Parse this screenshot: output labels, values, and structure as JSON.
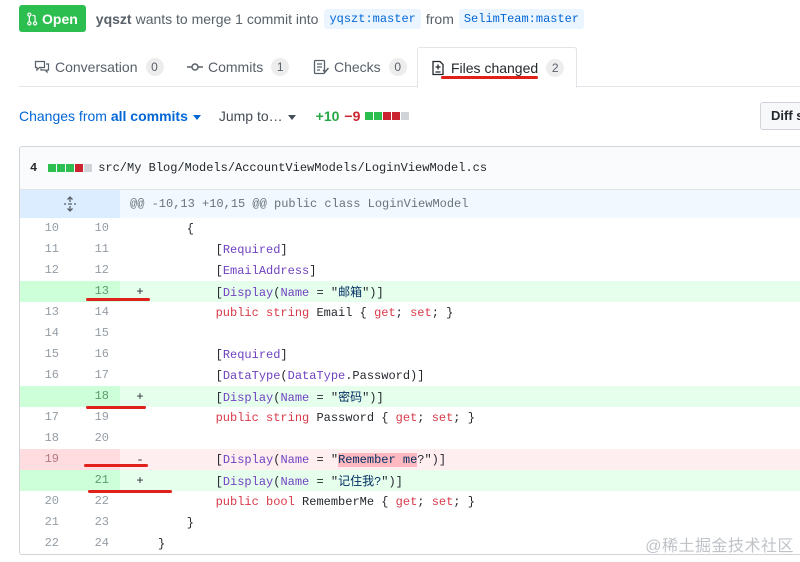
{
  "pr": {
    "state": "Open",
    "author": "yqszt",
    "message": "wants to merge 1 commit into",
    "base_branch": "yqszt:master",
    "from_word": "from",
    "head_branch": "SelimTeam:master"
  },
  "tabs": [
    {
      "label": "Conversation",
      "count": "0",
      "icon": "comment-discussion-icon"
    },
    {
      "label": "Commits",
      "count": "1",
      "icon": "git-commit-icon"
    },
    {
      "label": "Checks",
      "count": "0",
      "icon": "checklist-icon"
    },
    {
      "label": "Files changed",
      "count": "2",
      "icon": "file-diff-icon",
      "selected": true
    }
  ],
  "toolbar": {
    "changes_prefix": "Changes from",
    "changes_selected": "all commits",
    "jump_to": "Jump to…",
    "additions": "+10",
    "deletions": "−9",
    "diff_settings": "Diff s"
  },
  "file": {
    "changes": "4",
    "path": "src/My Blog/Models/AccountViewModels/LoginViewModel.cs",
    "hunk_header": "@@ -10,13 +10,15 @@ public class LoginViewModel",
    "lines": [
      {
        "old": "10",
        "new": "10",
        "type": "ctx",
        "marker": "",
        "code": "    {"
      },
      {
        "old": "11",
        "new": "11",
        "type": "ctx",
        "marker": "",
        "code": "        [Required]"
      },
      {
        "old": "12",
        "new": "12",
        "type": "ctx",
        "marker": "",
        "code": "        [EmailAddress]"
      },
      {
        "old": "",
        "new": "13",
        "type": "add",
        "marker": "+",
        "code": "        [Display(Name = \"邮箱\")]"
      },
      {
        "old": "13",
        "new": "14",
        "type": "ctx",
        "marker": "",
        "code": "        public string Email { get; set; }"
      },
      {
        "old": "14",
        "new": "15",
        "type": "ctx",
        "marker": "",
        "code": ""
      },
      {
        "old": "15",
        "new": "16",
        "type": "ctx",
        "marker": "",
        "code": "        [Required]"
      },
      {
        "old": "16",
        "new": "17",
        "type": "ctx",
        "marker": "",
        "code": "        [DataType(DataType.Password)]"
      },
      {
        "old": "",
        "new": "18",
        "type": "add",
        "marker": "+",
        "code": "        [Display(Name = \"密码\")]"
      },
      {
        "old": "17",
        "new": "19",
        "type": "ctx",
        "marker": "",
        "code": "        public string Password { get; set; }"
      },
      {
        "old": "18",
        "new": "20",
        "type": "ctx",
        "marker": "",
        "code": ""
      },
      {
        "old": "19",
        "new": "",
        "type": "del",
        "marker": "-",
        "code": "        [Display(Name = \"Remember me?\")]"
      },
      {
        "old": "",
        "new": "21",
        "type": "add",
        "marker": "+",
        "code": "        [Display(Name = \"记住我?\")]"
      },
      {
        "old": "20",
        "new": "22",
        "type": "ctx",
        "marker": "",
        "code": "        public bool RememberMe { get; set; }"
      },
      {
        "old": "21",
        "new": "23",
        "type": "ctx",
        "marker": "",
        "code": "    }"
      },
      {
        "old": "22",
        "new": "24",
        "type": "ctx",
        "marker": "",
        "code": "}"
      }
    ]
  },
  "watermark": "@稀土掘金技术社区",
  "colors": {
    "open_green": "#2cbe4e",
    "link_blue": "#0366d6",
    "add_bg": "#e6ffed",
    "del_bg": "#ffeef0",
    "annotation_red": "#e0201b"
  }
}
